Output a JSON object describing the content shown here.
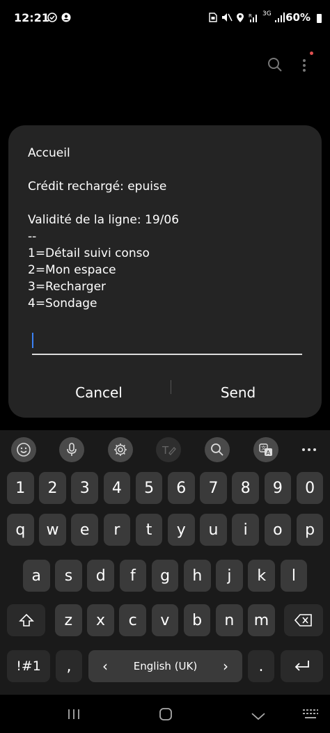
{
  "status_bar": {
    "time": "12:21",
    "battery": "60%",
    "network": "3G",
    "icons": [
      "check-circle-icon",
      "account-icon",
      "sim-icon",
      "mute-icon",
      "location-icon",
      "signal-icon",
      "signal-icon",
      "battery-icon"
    ]
  },
  "app_header": {
    "icons": [
      "search-icon",
      "more-vert-icon"
    ],
    "notification_dot_color": "#e05050"
  },
  "dialog": {
    "message": "Accueil\n\nCrédit rechargé: epuise\n\nValidité de la ligne: 19/06\n--\n1=Détail suivi conso\n2=Mon espace\n3=Recharger\n4=Sondage",
    "input_value": "",
    "cancel_label": "Cancel",
    "send_label": "Send",
    "accent_color": "#3b82f6"
  },
  "keyboard": {
    "toolbar": [
      "emoji-icon",
      "mic-icon",
      "settings-icon",
      "handwriting-icon",
      "search-icon",
      "translate-icon",
      "more-icon"
    ],
    "row_numbers": [
      "1",
      "2",
      "3",
      "4",
      "5",
      "6",
      "7",
      "8",
      "9",
      "0"
    ],
    "row_q": [
      "q",
      "w",
      "e",
      "r",
      "t",
      "y",
      "u",
      "i",
      "o",
      "p"
    ],
    "row_a": [
      "a",
      "s",
      "d",
      "f",
      "g",
      "h",
      "j",
      "k",
      "l"
    ],
    "row_z": [
      "z",
      "x",
      "c",
      "v",
      "b",
      "n",
      "m"
    ],
    "symbols_label": "!#1",
    "comma_label": ",",
    "period_label": ".",
    "language_label": "English (UK)",
    "lang_left": "‹",
    "lang_right": "›"
  },
  "nav_bar": {
    "icons": [
      "recents-icon",
      "home-icon",
      "back-icon",
      "keyboard-hide-icon"
    ]
  }
}
